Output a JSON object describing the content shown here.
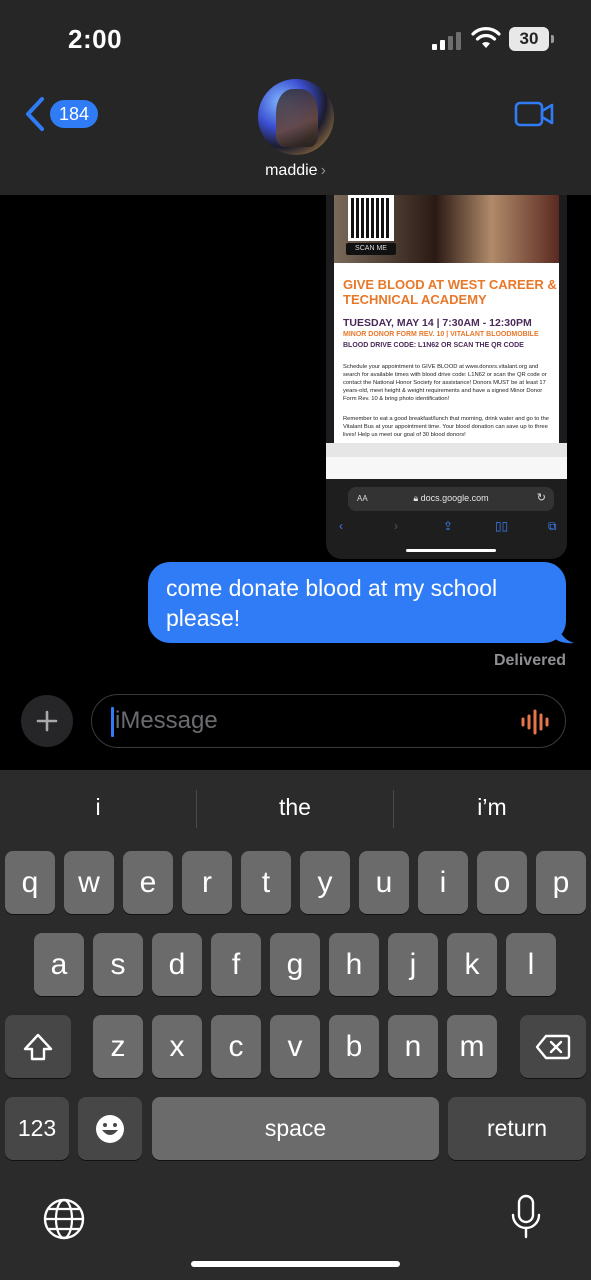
{
  "status_bar": {
    "time": "2:00",
    "battery": "30"
  },
  "header": {
    "back_count": "184",
    "contact_name": "maddie",
    "name_chevron": "›"
  },
  "attachment": {
    "scan_me": "SCAN ME",
    "title": "GIVE BLOOD AT WEST CAREER & TECHNICAL ACADEMY",
    "date_line": "TUESDAY, MAY 14 | 7:30AM - 12:30PM",
    "line1": "MINOR DONOR FORM REV. 10 | VITALANT BLOODMOBILE",
    "line2": "BLOOD DRIVE CODE: L1N62 OR SCAN THE QR CODE",
    "body1": "Schedule your appointment to GIVE BLOOD at www.donors.vitalant.org and search for available times with blood drive code: L1N62 or scan the QR code or contact the National Honor Society for assistance! Donors MUST be at least 17 years-old, meet height & weight requirements and have a signed Minor Donor Form Rev. 10 & bring photo identification!",
    "body2": "Remember to eat a good breakfast/lunch that morning, drink water and go to the Vitalant Bus at your appointment time. Your blood donation can save up to three lives! Help us meet our goal of 30 blood donors!",
    "url_aa": "AA",
    "url": "docs.google.com"
  },
  "message": {
    "text": "come donate blood at my school please!",
    "status": "Delivered"
  },
  "input": {
    "placeholder": "iMessage"
  },
  "keyboard": {
    "predictions": [
      "i",
      "the",
      "i’m"
    ],
    "row1": [
      "q",
      "w",
      "e",
      "r",
      "t",
      "y",
      "u",
      "i",
      "o",
      "p"
    ],
    "row2": [
      "a",
      "s",
      "d",
      "f",
      "g",
      "h",
      "j",
      "k",
      "l"
    ],
    "row3": [
      "z",
      "x",
      "c",
      "v",
      "b",
      "n",
      "m"
    ],
    "numbers_label": "123",
    "space_label": "space",
    "return_label": "return"
  },
  "colors": {
    "accent": "#2f7cf6",
    "key": "#6b6b6b",
    "key_dark": "#474747",
    "flyer_orange": "#e8782a",
    "flyer_purple": "#4a2a5a"
  }
}
